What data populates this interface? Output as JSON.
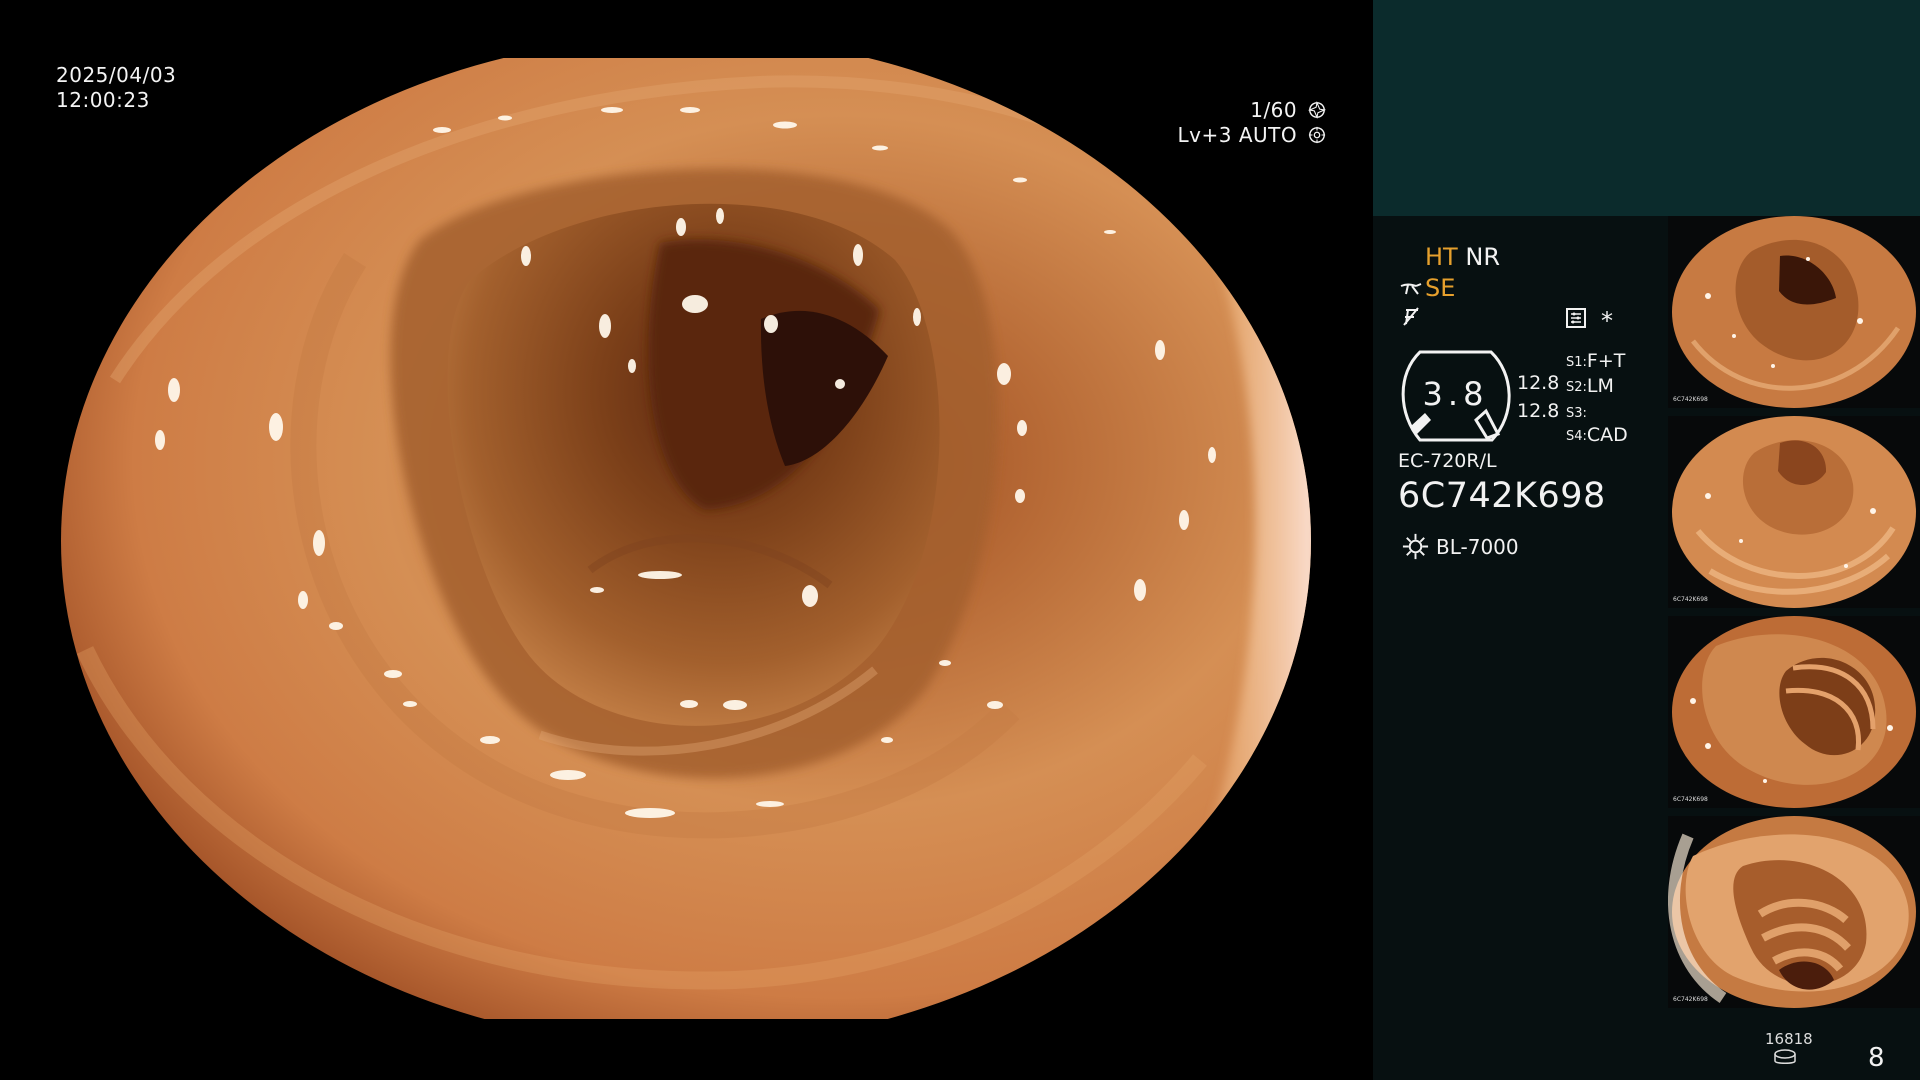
{
  "main_view": {
    "date": "2025/04/03",
    "time": "12:00:23",
    "shutter": "1/60",
    "shutter_icon": "aperture-icon",
    "exposure_level": "Lv+3",
    "exposure_mode": "AUTO",
    "exposure_icon": "auto-exposure-icon"
  },
  "status": {
    "ht": "HT",
    "nr": "NR",
    "se": "SE",
    "ht_color": "#e6a02d",
    "se_color": "#e6a02d",
    "icons": [
      "scope-tool-icon",
      "freeze-off-icon",
      "settings-icon",
      "asterisk-icon"
    ],
    "asterisk": "*"
  },
  "scope": {
    "gauge_value": "3.8",
    "upper_value": "12.8",
    "lower_value": "12.8",
    "settings": [
      {
        "key": "S1:",
        "value": "F+T"
      },
      {
        "key": "S2:",
        "value": "LM"
      },
      {
        "key": "S3:",
        "value": ""
      },
      {
        "key": "S4:",
        "value": "CAD"
      }
    ],
    "model": "EC-720R/L",
    "serial": "6C742K698",
    "light_source": "BL-7000",
    "light_icon": "light-source-icon"
  },
  "thumbnails": [
    {
      "id": "thumb-1",
      "label_serial": "6C742K698"
    },
    {
      "id": "thumb-2",
      "label_serial": "6C742K698"
    },
    {
      "id": "thumb-3",
      "label_serial": "6C742K698"
    },
    {
      "id": "thumb-4",
      "label_serial": "6C742K698"
    }
  ],
  "storage": {
    "count": "16818",
    "count_icon": "storage-icon",
    "page": "8"
  }
}
